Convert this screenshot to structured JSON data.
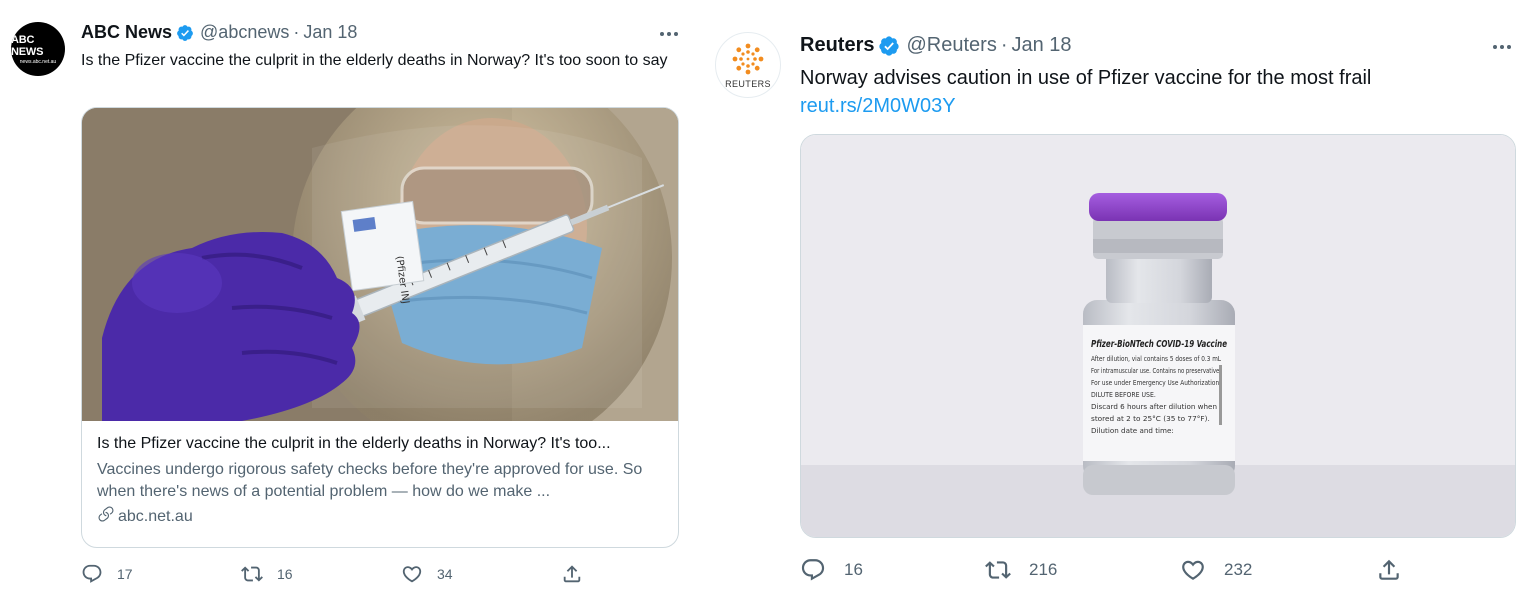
{
  "tweets": [
    {
      "account_name": "ABC News",
      "handle": "@abcnews",
      "separator": "·",
      "date": "Jan 18",
      "avatar_text_line1": "ABC NEWS",
      "avatar_text_line2": "news.abc.net.au",
      "text": "Is the Pfizer vaccine the culprit in the elderly deaths in Norway? It's too soon to say",
      "card": {
        "title": "Is the Pfizer vaccine the culprit in the elderly deaths in Norway? It's too...",
        "description": "Vaccines undergo rigorous safety checks before they're approved for use. So when there's news of a potential problem — how do we make ...",
        "domain": "abc.net.au",
        "photo_label": "(Pfizer INJ"
      },
      "replies": "17",
      "retweets": "16",
      "likes": "34"
    },
    {
      "account_name": "Reuters",
      "handle": "@Reuters",
      "separator": "·",
      "date": "Jan 18",
      "avatar_text": "REUTERS",
      "text": "Norway advises caution in use of Pfizer vaccine for the most frail",
      "link": "reut.rs/2M0W03Y",
      "vial_label": {
        "title": "Pfizer-BioNTech COVID-19 Vaccine",
        "lines": [
          "After dilution, vial contains 5 doses of 0.3 mL",
          "For intramuscular use. Contains no preservative.",
          "For use under Emergency Use Authorization.",
          "DILUTE BEFORE USE.",
          "Discard 6 hours after dilution when",
          "stored at 2 to 25°C (35 to 77°F).",
          "Dilution date and time:"
        ]
      },
      "replies": "16",
      "retweets": "216",
      "likes": "232"
    }
  ],
  "colors": {
    "verified": "#1d9bf0",
    "link": "#1d9bf0",
    "secondary_text": "#536471",
    "primary_text": "#0f1419",
    "vial_cap": "#8a3fc4",
    "glove": "#4b2aa8",
    "mask": "#6fa6d0"
  },
  "icons": [
    "verified-badge-icon",
    "more-icon",
    "reply-icon",
    "retweet-icon",
    "like-icon",
    "share-icon",
    "link-icon"
  ]
}
